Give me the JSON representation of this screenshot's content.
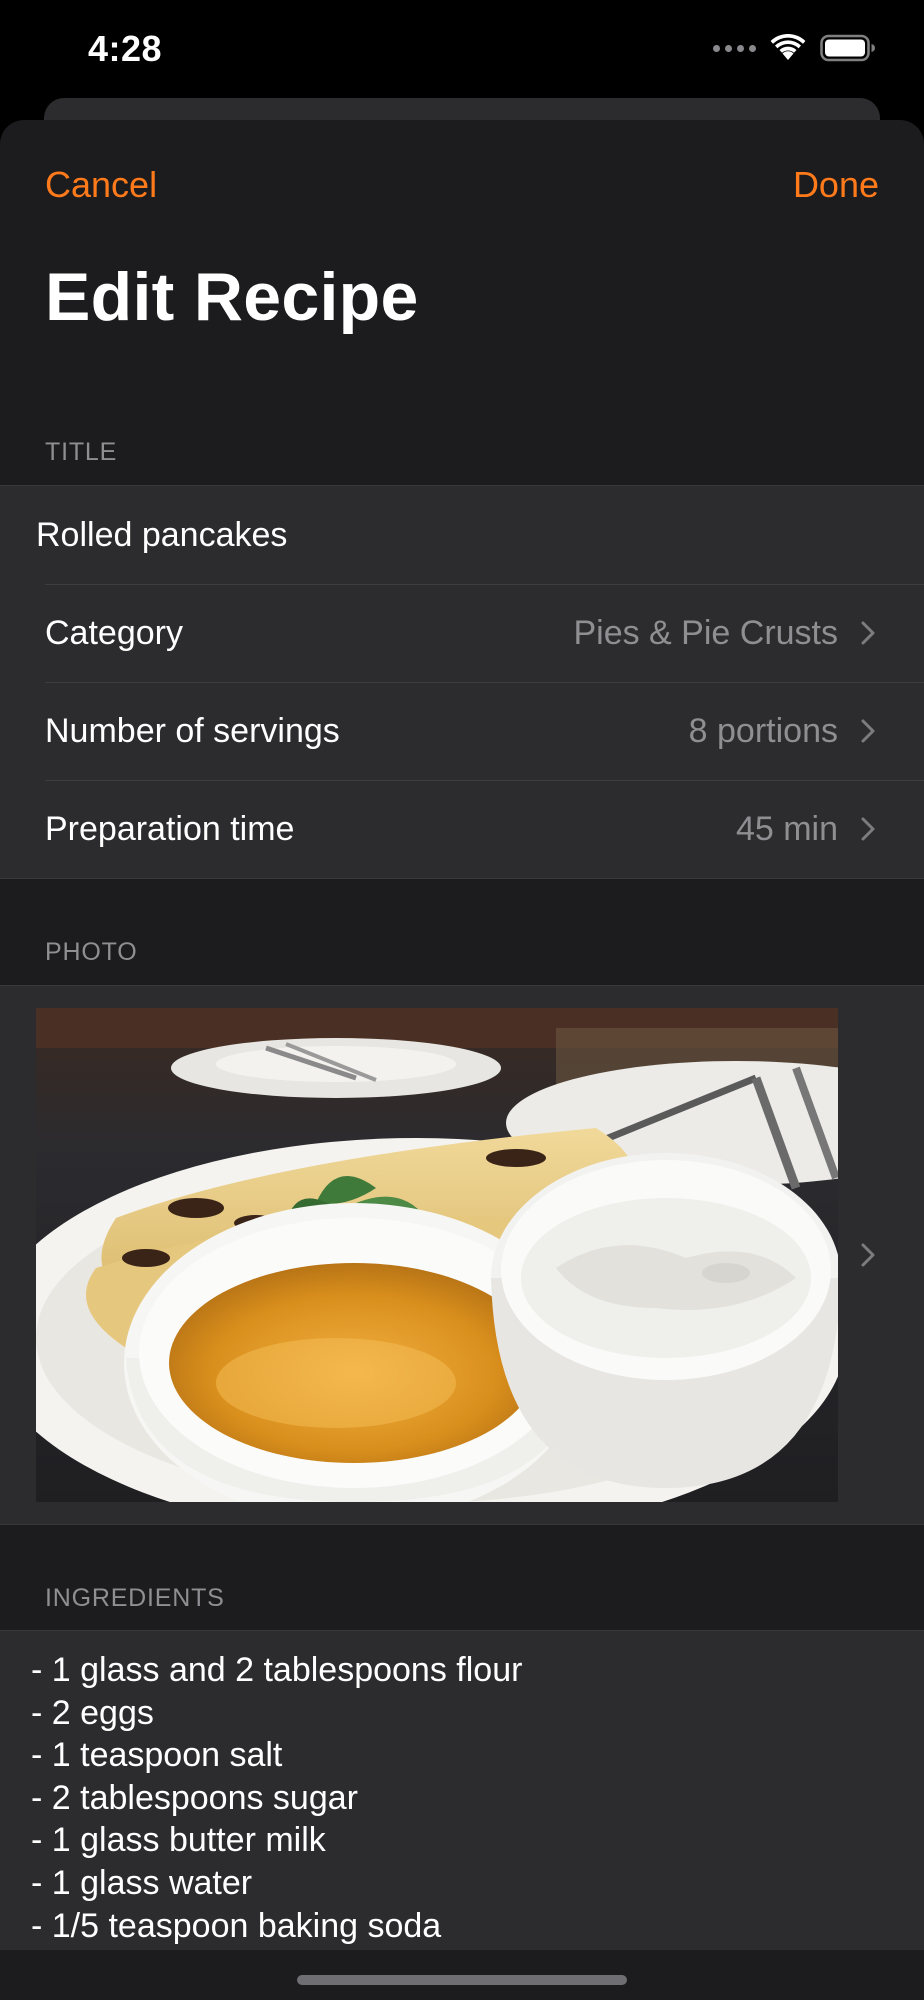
{
  "status_bar": {
    "time": "4:28"
  },
  "nav": {
    "cancel_label": "Cancel",
    "done_label": "Done",
    "title": "Edit Recipe"
  },
  "sections": {
    "title_header": "TITLE",
    "photo_header": "PHOTO",
    "ingredients_header": "INGREDIENTS"
  },
  "form": {
    "title_value": "Rolled pancakes",
    "rows": [
      {
        "label": "Category",
        "value": "Pies & Pie Crusts"
      },
      {
        "label": "Number of servings",
        "value": "8 portions"
      },
      {
        "label": "Preparation time",
        "value": "45 min"
      }
    ]
  },
  "ingredients": [
    "- 1 glass and 2 tablespoons flour",
    "- 2 eggs",
    "- 1 teaspoon salt",
    "- 2 tablespoons sugar",
    "- 1 glass butter milk",
    "- 1 glass water",
    "- 1/5 teaspoon baking soda"
  ],
  "colors": {
    "accent": "#ff7a1a",
    "background": "#1c1c1e",
    "cell": "#2c2c2e",
    "secondary_text": "#8e8e93"
  },
  "icons": [
    "cellular-dots-icon",
    "wifi-icon",
    "battery-icon",
    "chevron-right-icon"
  ]
}
